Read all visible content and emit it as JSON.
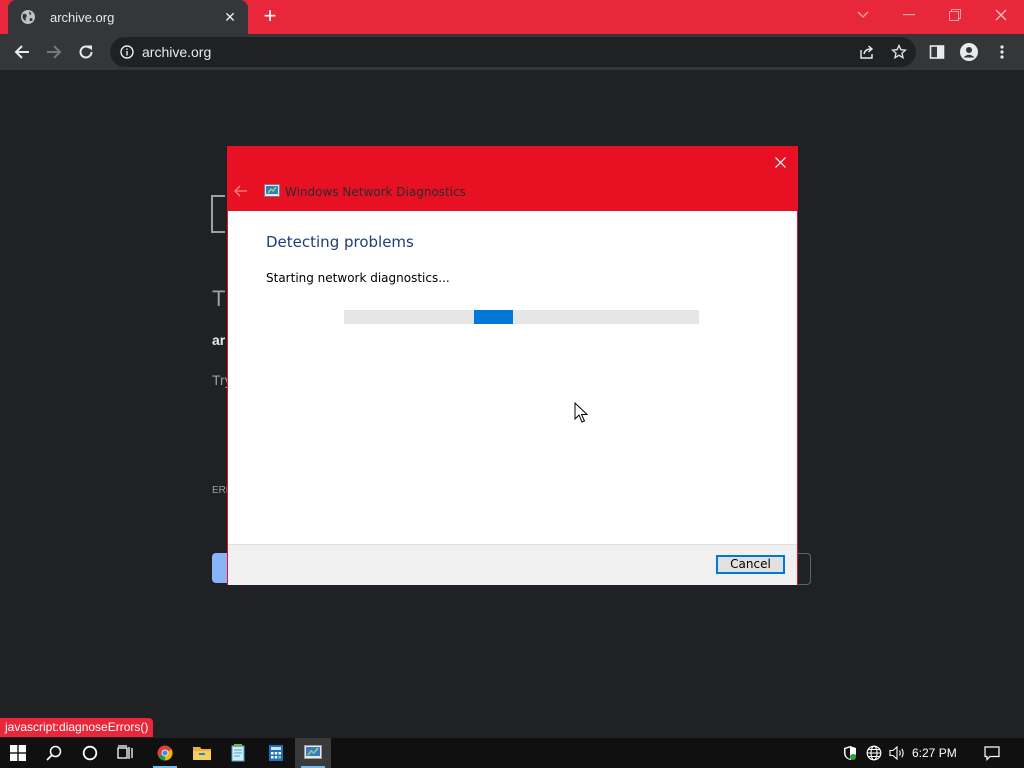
{
  "browser": {
    "tab": {
      "title": "archive.org",
      "close_glyph": "✕"
    },
    "new_tab_glyph": "+",
    "window_controls": {
      "dropdown": "⌄",
      "minimize": "—",
      "restore": "❐",
      "close": "✕"
    },
    "address": {
      "url": "archive.org"
    },
    "icons": [
      "back-icon",
      "forward-icon",
      "reload-icon",
      "info-icon",
      "share-icon",
      "star-icon",
      "side-panel-icon",
      "profile-icon",
      "menu-icon"
    ]
  },
  "background_page": {
    "frag_T": "T",
    "frag_ar": "ar",
    "frag_try": "Try",
    "frag_err": "ERR"
  },
  "dialog": {
    "title": "Windows Network Diagnostics",
    "heading": "Detecting problems",
    "status": "Starting network diagnostics...",
    "progress": {
      "type": "indeterminate",
      "chunk_position_fraction": 0.365
    },
    "cancel_label": "Cancel",
    "close_glyph": "✕",
    "header_color": "#e81123",
    "accent_color": "#0078d7"
  },
  "status_bubble": {
    "text": "javascript:diagnoseErrors()"
  },
  "taskbar": {
    "apps": [
      "start-icon",
      "search-icon",
      "cortana-icon",
      "task-view-icon",
      "chrome-icon",
      "file-explorer-icon",
      "notepad-icon",
      "calculator-icon",
      "network-diagnostics-icon"
    ],
    "tray": [
      "security-icon",
      "network-icon",
      "volume-icon"
    ],
    "clock": "6:27 PM"
  },
  "colors": {
    "chrome_titlebar": "#e8283a",
    "page_bg": "#202124"
  }
}
